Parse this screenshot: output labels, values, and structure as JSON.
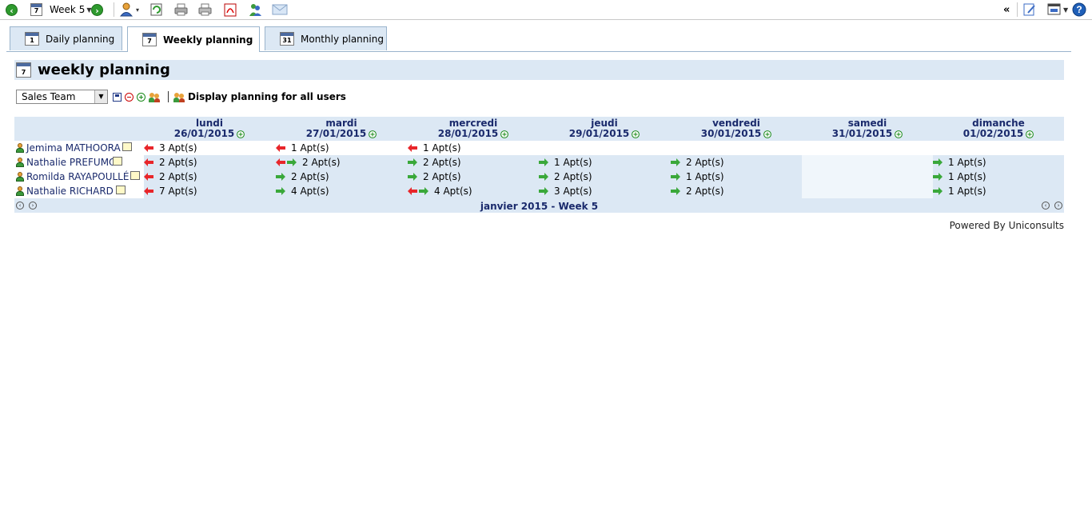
{
  "toolbar": {
    "week_label": "Week 5",
    "collapse_glyph": "«"
  },
  "tabs": [
    {
      "label": "Daily planning",
      "icon_num": "1"
    },
    {
      "label": "Weekly planning",
      "icon_num": "7"
    },
    {
      "label": "Monthly planning",
      "icon_num": "31"
    }
  ],
  "page": {
    "title": "weekly planning",
    "title_icon_num": "7"
  },
  "filter": {
    "group_selected": "Sales Team",
    "display_all_label": "Display planning for all users"
  },
  "days": [
    {
      "name": "lundi",
      "date": "26/01/2015"
    },
    {
      "name": "mardi",
      "date": "27/01/2015"
    },
    {
      "name": "mercredi",
      "date": "28/01/2015"
    },
    {
      "name": "jeudi",
      "date": "29/01/2015"
    },
    {
      "name": "vendredi",
      "date": "30/01/2015"
    },
    {
      "name": "samedi",
      "date": "31/01/2015"
    },
    {
      "name": "dimanche",
      "date": "01/02/2015"
    }
  ],
  "users": [
    {
      "name": "Jemima MATHOORA",
      "cells": [
        {
          "text": "3 Apt(s)",
          "arrows": [
            "left"
          ]
        },
        {
          "text": "1 Apt(s)",
          "arrows": [
            "left"
          ]
        },
        {
          "text": "1 Apt(s)",
          "arrows": [
            "left"
          ]
        },
        null,
        null,
        null,
        null
      ]
    },
    {
      "name": "Nathalie PREFUMO",
      "cells": [
        {
          "text": "2 Apt(s)",
          "arrows": [
            "left"
          ]
        },
        {
          "text": "2 Apt(s)",
          "arrows": [
            "left",
            "right"
          ]
        },
        {
          "text": "2 Apt(s)",
          "arrows": [
            "right"
          ]
        },
        {
          "text": "1 Apt(s)",
          "arrows": [
            "right"
          ]
        },
        {
          "text": "2 Apt(s)",
          "arrows": [
            "right"
          ]
        },
        null,
        {
          "text": "1 Apt(s)",
          "arrows": [
            "right"
          ]
        }
      ]
    },
    {
      "name": "Romilda RAYAPOULLÉ",
      "cells": [
        {
          "text": "2 Apt(s)",
          "arrows": [
            "left"
          ]
        },
        {
          "text": "2 Apt(s)",
          "arrows": [
            "right"
          ]
        },
        {
          "text": "2 Apt(s)",
          "arrows": [
            "right"
          ]
        },
        {
          "text": "2 Apt(s)",
          "arrows": [
            "right"
          ]
        },
        {
          "text": "1 Apt(s)",
          "arrows": [
            "right"
          ]
        },
        null,
        {
          "text": "1 Apt(s)",
          "arrows": [
            "right"
          ]
        }
      ]
    },
    {
      "name": "Nathalie RICHARD",
      "cells": [
        {
          "text": "7 Apt(s)",
          "arrows": [
            "left"
          ]
        },
        {
          "text": "4 Apt(s)",
          "arrows": [
            "right"
          ]
        },
        {
          "text": "4 Apt(s)",
          "arrows": [
            "left",
            "right"
          ]
        },
        {
          "text": "3 Apt(s)",
          "arrows": [
            "right"
          ]
        },
        {
          "text": "2 Apt(s)",
          "arrows": [
            "right"
          ]
        },
        null,
        {
          "text": "1 Apt(s)",
          "arrows": [
            "right"
          ]
        }
      ]
    }
  ],
  "footer": {
    "period_label": "janvier 2015 - Week 5"
  },
  "powered_by": "Powered By Uniconsults",
  "colors": {
    "header_bg": "#dce8f4",
    "link_blue": "#1a2a6c",
    "arrow_red": "#e8262a",
    "arrow_green": "#3aa83a"
  }
}
